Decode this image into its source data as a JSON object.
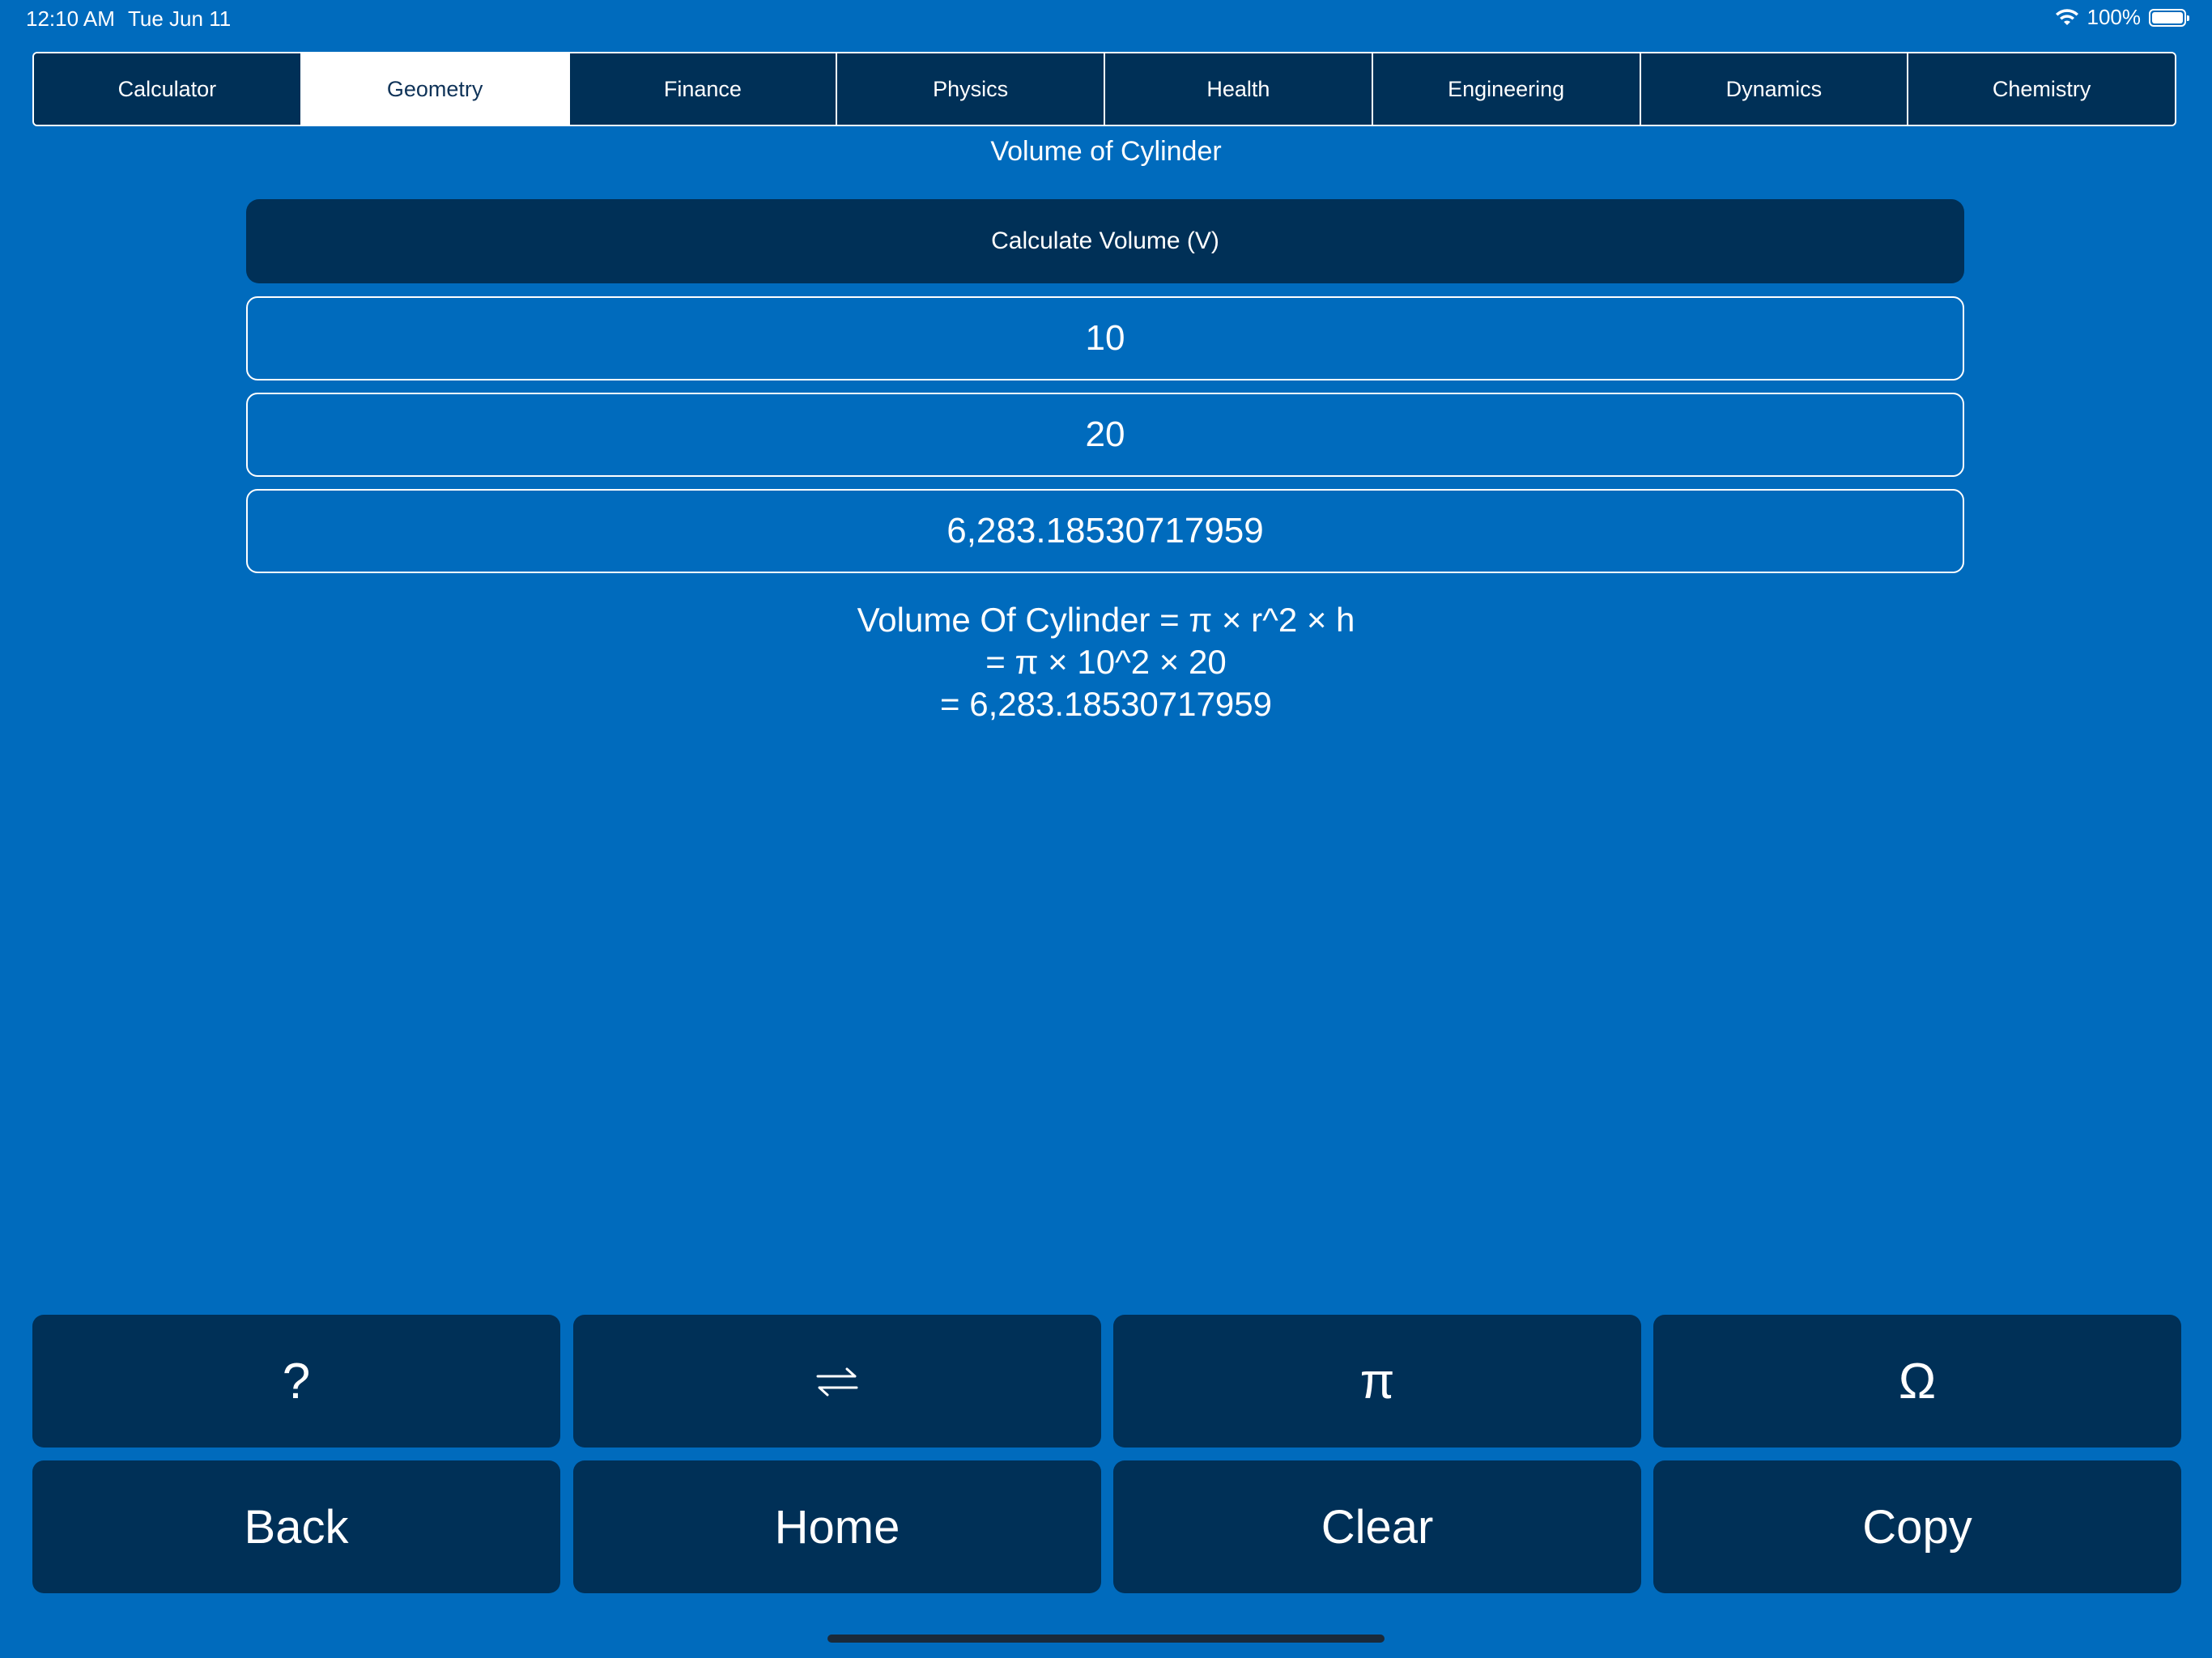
{
  "status": {
    "time": "12:10 AM",
    "date": "Tue Jun 11",
    "battery": "100%"
  },
  "tabs": [
    {
      "label": "Calculator",
      "active": false
    },
    {
      "label": "Geometry",
      "active": true
    },
    {
      "label": "Finance",
      "active": false
    },
    {
      "label": "Physics",
      "active": false
    },
    {
      "label": "Health",
      "active": false
    },
    {
      "label": "Engineering",
      "active": false
    },
    {
      "label": "Dynamics",
      "active": false
    },
    {
      "label": "Chemistry",
      "active": false
    }
  ],
  "title": "Volume of Cylinder",
  "calculate_label": "Calculate Volume (V)",
  "fields": {
    "radius": "10",
    "height": "20",
    "result": "6,283.18530717959"
  },
  "formula": {
    "line1": "Volume Of Cylinder = π × r^2 × h",
    "line2": "=  π × 10^2 × 20",
    "line3": "= 6,283.18530717959"
  },
  "keypad": {
    "help": "?",
    "swap_icon": "swap-arrows-icon",
    "pi": "π",
    "omega": "Ω",
    "back": "Back",
    "home": "Home",
    "clear": "Clear",
    "copy": "Copy"
  },
  "colors": {
    "background": "#006bbd",
    "dark": "#003057",
    "text": "#ffffff"
  }
}
